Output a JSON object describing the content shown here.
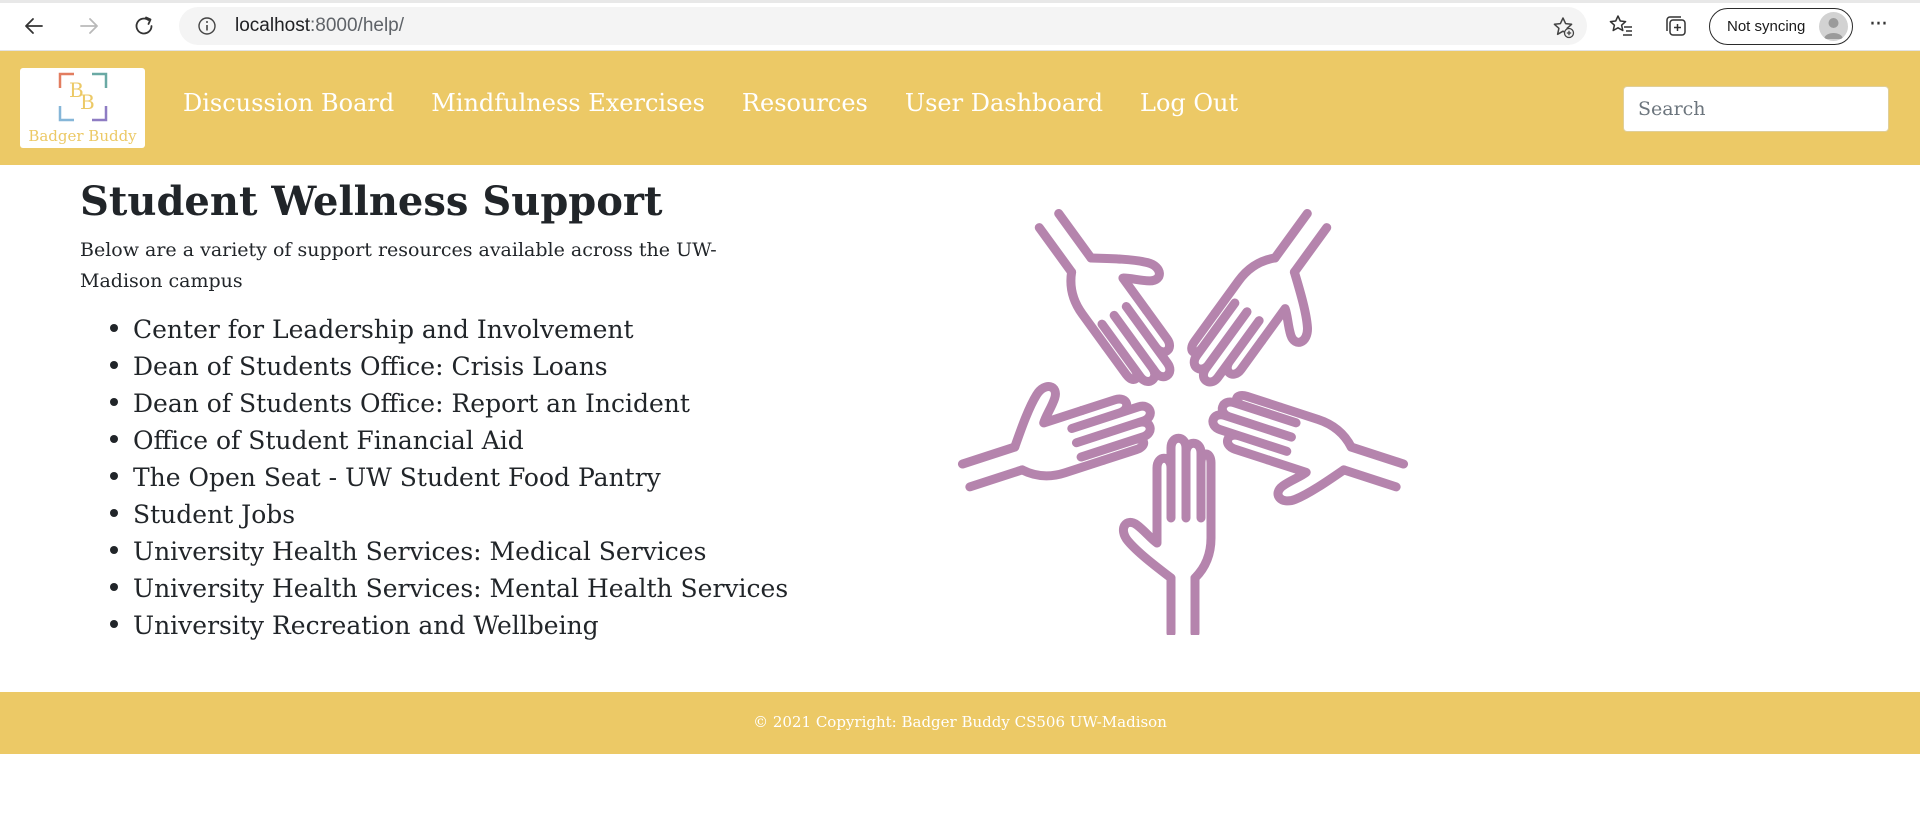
{
  "browser": {
    "url_host": "localhost",
    "url_path": ":8000/help/",
    "sync_label": "Not syncing"
  },
  "site": {
    "logo_letters": "BB",
    "logo_text": "Badger Buddy",
    "nav": [
      {
        "label": "Discussion Board"
      },
      {
        "label": "Mindfulness Exercises"
      },
      {
        "label": "Resources"
      },
      {
        "label": "User Dashboard"
      },
      {
        "label": "Log Out"
      }
    ],
    "search_placeholder": "Search"
  },
  "main": {
    "title": "Student Wellness Support",
    "intro": "Below are a variety of support resources available across the UW-Madison campus",
    "resources": [
      {
        "label": "Center for Leadership and Involvement"
      },
      {
        "label": "Dean of Students Office: Crisis Loans"
      },
      {
        "label": "Dean of Students Office: Report an Incident"
      },
      {
        "label": "Office of Student Financial Aid"
      },
      {
        "label": "The Open Seat - UW Student Food Pantry"
      },
      {
        "label": "Student Jobs"
      },
      {
        "label": "University Health Services: Medical Services"
      },
      {
        "label": "University Health Services: Mental Health Services"
      },
      {
        "label": "University Recreation and Wellbeing"
      }
    ]
  },
  "footer": {
    "text": "© 2021 Copyright: Badger Buddy CS506 UW-Madison"
  },
  "colors": {
    "brand": "#ecc966",
    "illustration": "#b584ad",
    "text": "#212529"
  },
  "icons": [
    "back-arrow-icon",
    "forward-arrow-icon",
    "reload-icon",
    "info-icon",
    "add-favorite-icon",
    "favorites-icon",
    "collections-icon",
    "profile-avatar-icon",
    "more-menu-icon",
    "logo-mark",
    "hands-circle-illustration"
  ]
}
